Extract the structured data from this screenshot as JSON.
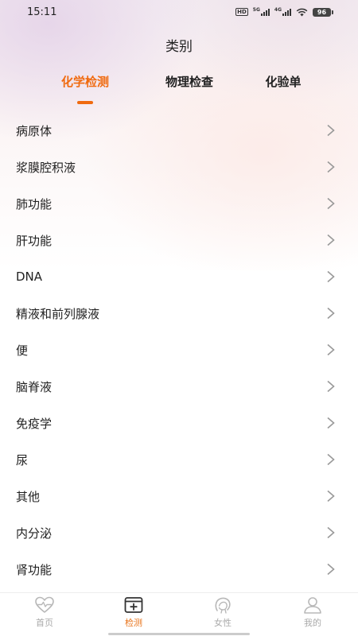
{
  "status_bar": {
    "time": "15:11",
    "hd_label": "HD",
    "net1": "5G",
    "net2": "4G",
    "battery": "96"
  },
  "header": {
    "title": "类别"
  },
  "tabs": [
    {
      "label": "化学检测",
      "active": true
    },
    {
      "label": "物理检查",
      "active": false
    },
    {
      "label": "化验单",
      "active": false
    }
  ],
  "categories": [
    {
      "label": "病原体"
    },
    {
      "label": "浆膜腔积液"
    },
    {
      "label": "肺功能"
    },
    {
      "label": "肝功能"
    },
    {
      "label": "DNA"
    },
    {
      "label": "精液和前列腺液"
    },
    {
      "label": "便"
    },
    {
      "label": "脑脊液"
    },
    {
      "label": "免疫学"
    },
    {
      "label": "尿"
    },
    {
      "label": "其他"
    },
    {
      "label": "内分泌"
    },
    {
      "label": "肾功能"
    }
  ],
  "bottom_nav": [
    {
      "label": "首页",
      "icon": "heart-pulse-icon",
      "active": false
    },
    {
      "label": "检测",
      "icon": "medical-box-icon",
      "active": true
    },
    {
      "label": "女性",
      "icon": "female-head-icon",
      "active": false
    },
    {
      "label": "我的",
      "icon": "user-icon",
      "active": false
    }
  ],
  "colors": {
    "accent": "#f06a0f",
    "text": "#222222",
    "inactive_nav": "#aaaaaa",
    "chevron": "#999999"
  }
}
